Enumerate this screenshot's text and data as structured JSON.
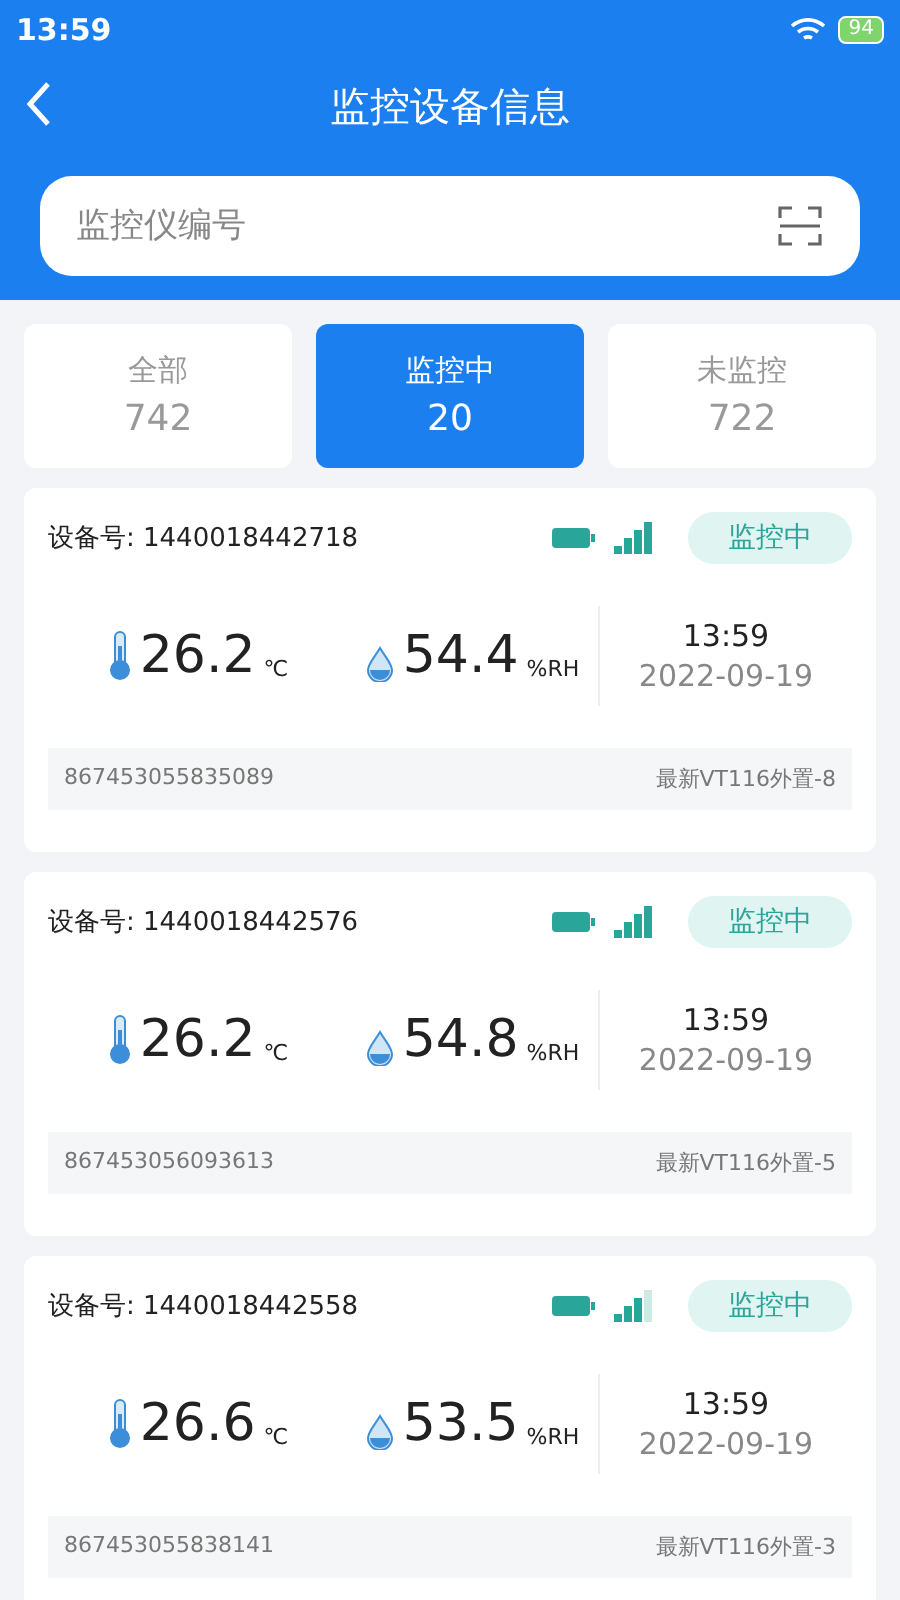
{
  "status_bar": {
    "time": "13:59",
    "battery": "94"
  },
  "header": {
    "title": "监控设备信息"
  },
  "search": {
    "placeholder": "监控仪编号"
  },
  "tabs": [
    {
      "label": "全部",
      "count": "742",
      "selected": false
    },
    {
      "label": "监控中",
      "count": "20",
      "selected": true
    },
    {
      "label": "未监控",
      "count": "722",
      "selected": false
    }
  ],
  "devices": [
    {
      "device_label": "设备号: 1440018442718",
      "weak_signal": false,
      "status": "监控中",
      "temperature": "26.2",
      "temp_unit": "℃",
      "humidity": "54.4",
      "humidity_unit": "%RH",
      "time": "13:59",
      "date": "2022-09-19",
      "imei": "867453055835089",
      "model": "最新VT116外置-8"
    },
    {
      "device_label": "设备号: 1440018442576",
      "weak_signal": false,
      "status": "监控中",
      "temperature": "26.2",
      "temp_unit": "℃",
      "humidity": "54.8",
      "humidity_unit": "%RH",
      "time": "13:59",
      "date": "2022-09-19",
      "imei": "867453056093613",
      "model": "最新VT116外置-5"
    },
    {
      "device_label": "设备号: 1440018442558",
      "weak_signal": true,
      "status": "监控中",
      "temperature": "26.6",
      "temp_unit": "℃",
      "humidity": "53.5",
      "humidity_unit": "%RH",
      "time": "13:59",
      "date": "2022-09-19",
      "imei": "867453055838141",
      "model": "最新VT116外置-3"
    }
  ]
}
